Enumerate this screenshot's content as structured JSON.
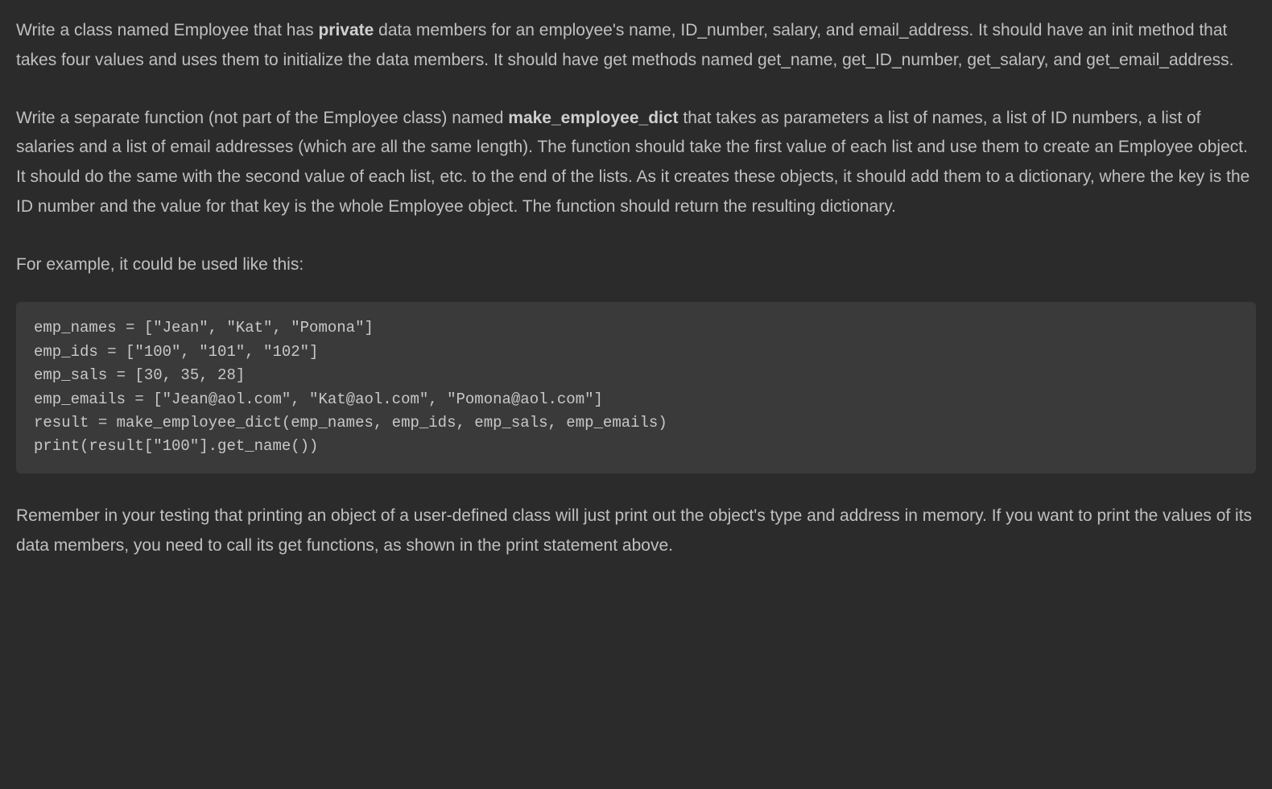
{
  "paragraphs": {
    "p1_before_bold": "Write a class named Employee that has ",
    "p1_bold": "private",
    "p1_after_bold": " data members for an employee's name, ID_number, salary, and email_address. It should have an init method that takes four values and uses them to initialize the data members. It should have get methods named get_name, get_ID_number, get_salary, and get_email_address.",
    "p2_before_bold": "Write a separate function (not part of the Employee class) named ",
    "p2_bold": "make_employee_dict",
    "p2_after_bold": " that takes as parameters a list of names, a list of ID numbers, a list of salaries and a list of email addresses (which are all the same length). The function should take the first value of each list and use them to create an Employee object. It should do the same with the second value of each list, etc. to the end of the lists. As it creates these objects, it should add them to a dictionary, where the key is the ID number and the value for that key is the whole Employee object. The function should return the resulting dictionary.",
    "p3": "For example, it could be used like this:",
    "p4": "Remember in your testing that printing an object of a user-defined class will just print out the object's type and address in memory. If you want to print the values of its data members, you need to call its get functions, as shown in the print statement above."
  },
  "code_example": "emp_names = [\"Jean\", \"Kat\", \"Pomona\"]\nemp_ids = [\"100\", \"101\", \"102\"]\nemp_sals = [30, 35, 28]\nemp_emails = [\"Jean@aol.com\", \"Kat@aol.com\", \"Pomona@aol.com\"]\nresult = make_employee_dict(emp_names, emp_ids, emp_sals, emp_emails)\nprint(result[\"100\"].get_name())"
}
